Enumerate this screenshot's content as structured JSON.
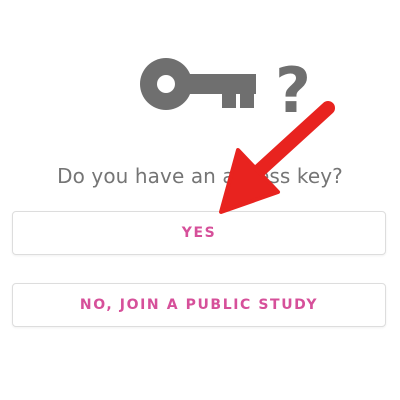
{
  "prompt": {
    "question": "Do you have an access key?"
  },
  "icons": {
    "key": "key-icon",
    "question_mark": "?"
  },
  "buttons": {
    "yes_label": "YES",
    "public_study_label": "NO, JOIN A PUBLIC STUDY"
  },
  "colors": {
    "accent": "#d6509a",
    "icon": "#6f6f6f",
    "text": "#757575",
    "annotation_arrow": "#e8231f"
  }
}
